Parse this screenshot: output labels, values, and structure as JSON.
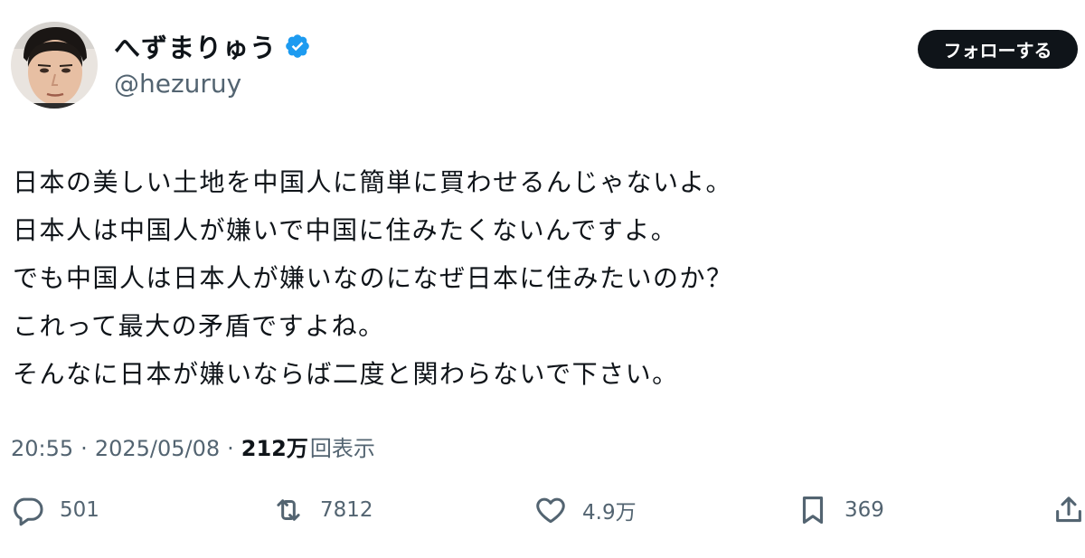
{
  "author": {
    "name": "へずまりゅう",
    "handle": "@hezuruy",
    "verified": true
  },
  "follow_button": {
    "label": "フォローする"
  },
  "tweet": {
    "lines": [
      "日本の美しい土地を中国人に簡単に買わせるんじゃないよ。",
      "日本人は中国人が嫌いで中国に住みたくないんですよ。",
      "でも中国人は日本人が嫌いなのになぜ日本に住みたいのか？",
      "これって最大の矛盾ですよね。",
      "そんなに日本が嫌いならば二度と関わらないで下さい。"
    ],
    "time": "20:55",
    "date": "2025/05/08",
    "separator": "·",
    "views_count": "212万",
    "views_label": "回表示"
  },
  "actions": {
    "reply_count": "501",
    "retweet_count": "7812",
    "like_count": "4.9万",
    "bookmark_count": "369"
  },
  "colors": {
    "text": "#0f1419",
    "secondary": "#536471",
    "verified": "#1d9bf0",
    "follow_bg": "#0f1419"
  }
}
